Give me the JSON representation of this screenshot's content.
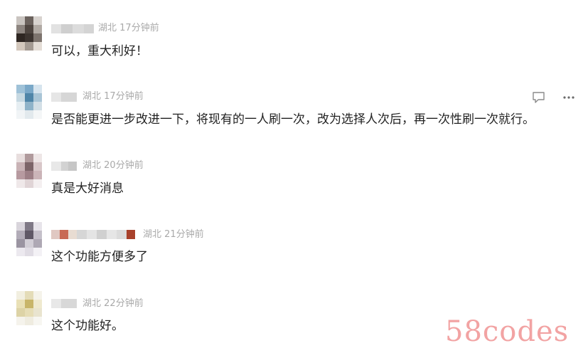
{
  "comments": [
    {
      "location": "湖北",
      "time": "17分钟前",
      "text": "可以，重大利好！"
    },
    {
      "location": "湖北",
      "time": "17分钟前",
      "text": "是否能更进一步改进一下，将现有的一人刷一次，改为选择人次后，再一次性刷一次就行。"
    },
    {
      "location": "湖北",
      "time": "20分钟前",
      "text": "真是大好消息"
    },
    {
      "location": "湖北",
      "time": "21分钟前",
      "text": "这个功能方便多了"
    },
    {
      "location": "湖北",
      "time": "22分钟前",
      "text": "这个功能好。"
    }
  ],
  "actions": {
    "reply_icon": "comment-bubble-icon",
    "more_icon": "more-dots-icon"
  },
  "watermark": "58codes"
}
